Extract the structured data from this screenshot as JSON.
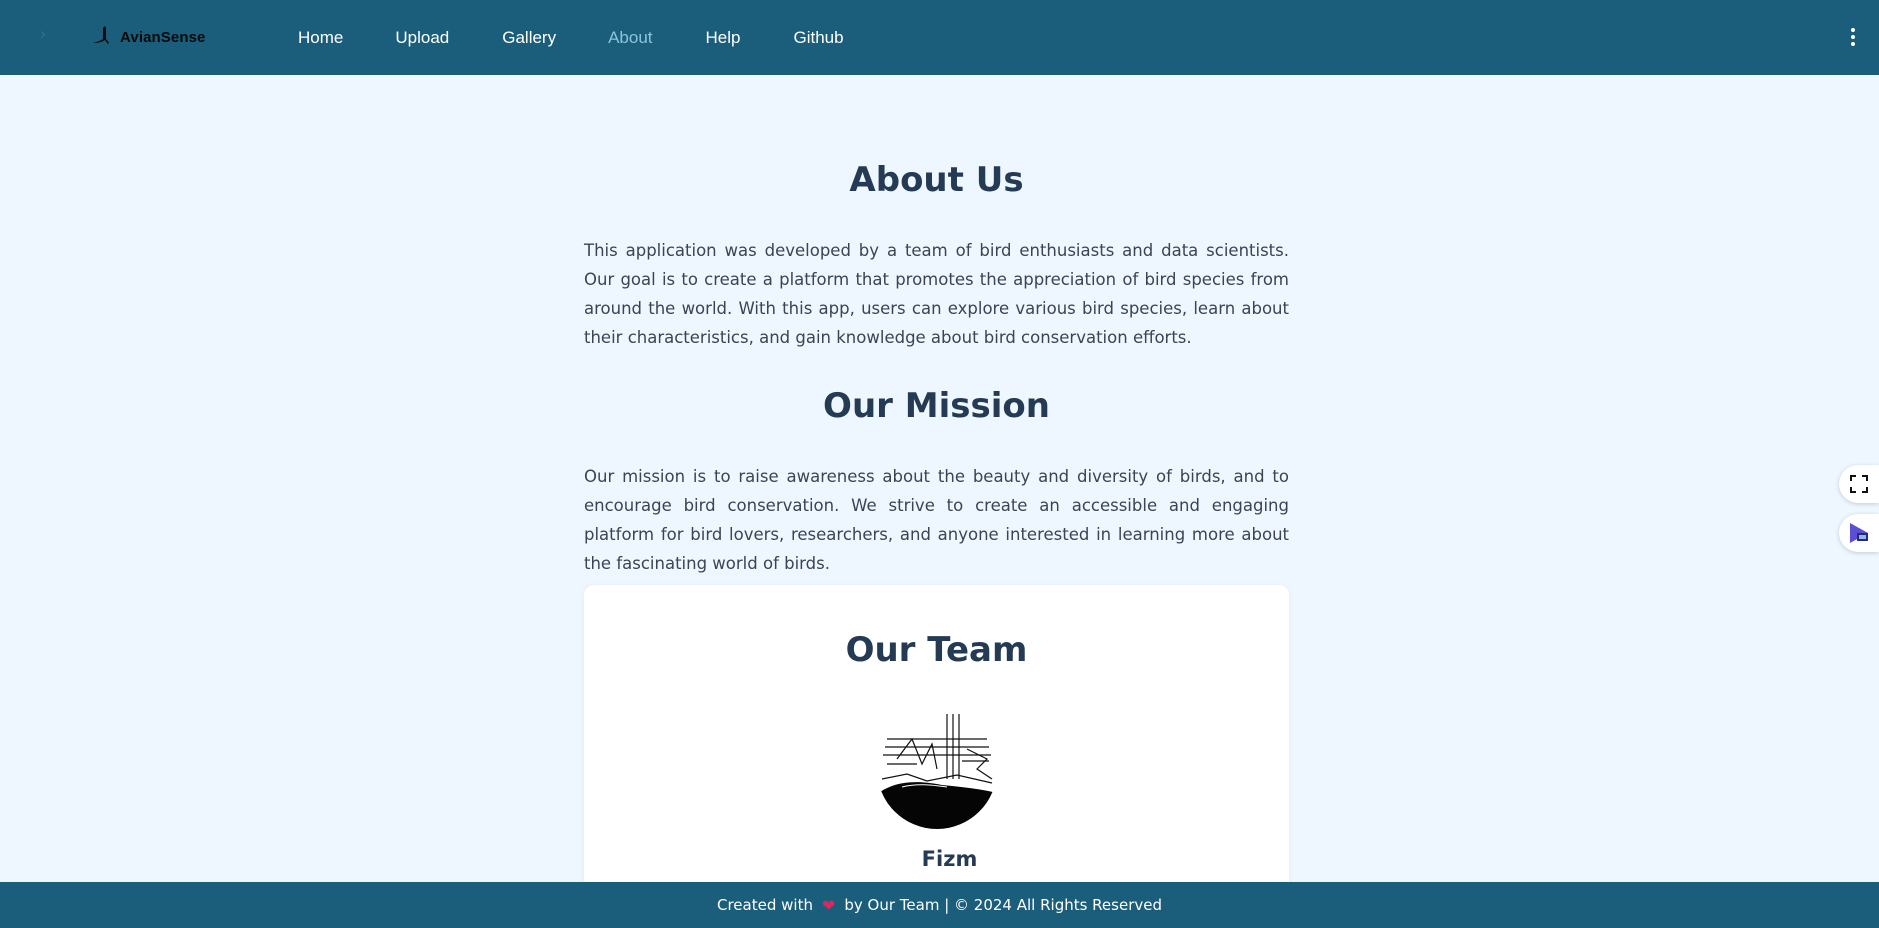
{
  "header": {
    "logo_text": "AvianSense",
    "nav": [
      {
        "label": "Home"
      },
      {
        "label": "Upload"
      },
      {
        "label": "Gallery"
      },
      {
        "label": "About",
        "active": true
      },
      {
        "label": "Help"
      },
      {
        "label": "Github"
      }
    ]
  },
  "about": {
    "title": "About Us",
    "text": "This application was developed by a team of bird enthusiasts and data scientists. Our goal is to create a platform that promotes the appreciation of bird species from around the world. With this app, users can explore various bird species, learn about their characteristics, and gain knowledge about bird conservation efforts."
  },
  "mission": {
    "title": "Our Mission",
    "text": "Our mission is to raise awareness about the beauty and diversity of birds, and to encourage bird conservation. We strive to create an accessible and engaging platform for bird lovers, researchers, and anyone interested in learning more about the fascinating world of birds."
  },
  "team": {
    "title": "Our Team",
    "members": [
      {
        "name": "Fizm"
      }
    ]
  },
  "footer": {
    "created_with": "Created with",
    "by_text": "by Our Team | © 2024 All Rights Reserved"
  },
  "colors": {
    "navbar": "#1b5e7b",
    "background": "#eef7ff",
    "heading": "#243b53",
    "nav_active": "#8cc3dd"
  },
  "icons": [
    "chevron-right-icon",
    "bird-logo-icon",
    "kebab-menu-icon",
    "heart-icon",
    "fullscreen-icon",
    "extension-icon"
  ]
}
